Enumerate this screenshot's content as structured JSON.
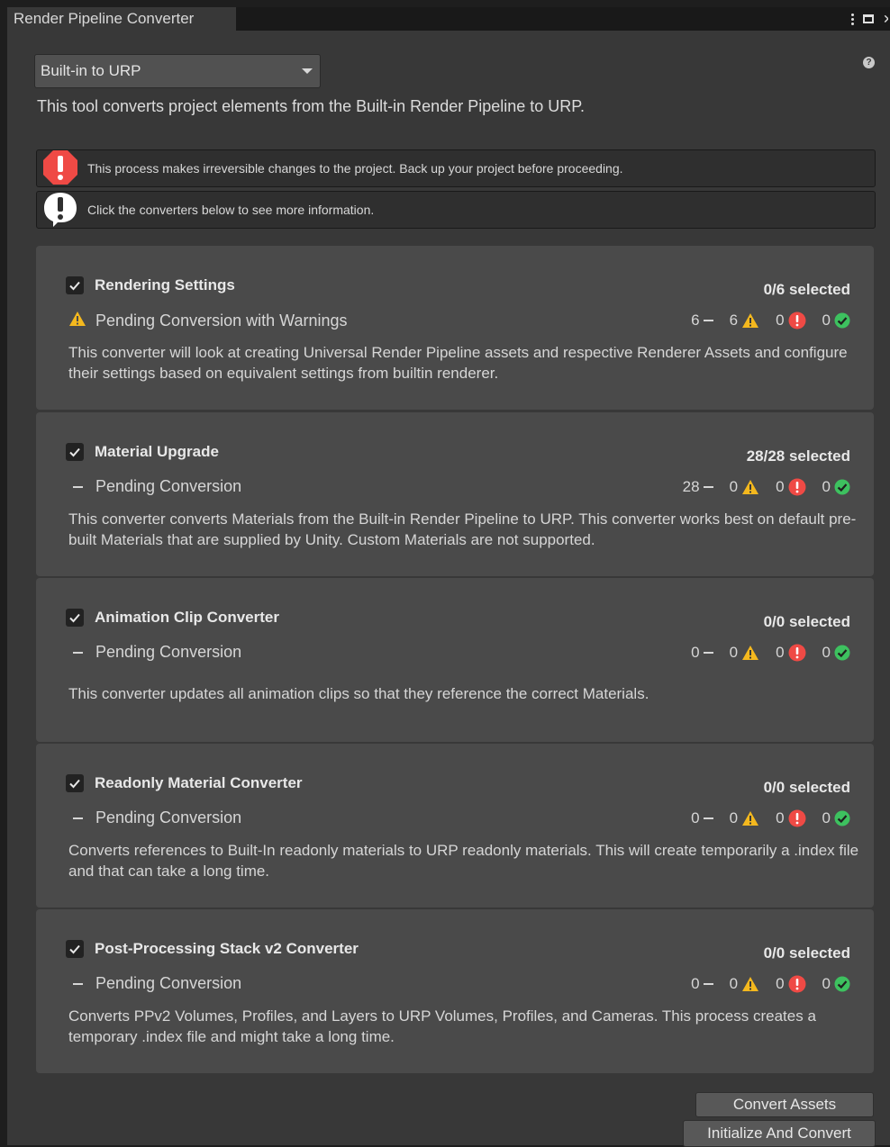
{
  "window": {
    "tab_title": "Render Pipeline Converter"
  },
  "dropdown": {
    "value": "Built-in to URP"
  },
  "description": "This tool converts project elements from the Built-in Render Pipeline to URP.",
  "help_boxes": [
    {
      "text": "This process makes irreversible changes to the project. Back up your project before proceeding."
    },
    {
      "text": "Click the converters below to see more information."
    }
  ],
  "converters": [
    {
      "name": "Rendering Settings",
      "selected": "0/6 selected",
      "status": "Pending Conversion with Warnings",
      "status_icon": "warning-icon",
      "count_pending": "6",
      "count_warnings": "6",
      "count_errors": "0",
      "count_success": "0",
      "description": "This converter will look at creating Universal Render Pipeline assets and respective Renderer Assets and configure their settings based on equivalent settings from builtin renderer."
    },
    {
      "name": "Material Upgrade",
      "selected": "28/28 selected",
      "status": "Pending Conversion",
      "status_icon": "dash-icon",
      "count_pending": "28",
      "count_warnings": "0",
      "count_errors": "0",
      "count_success": "0",
      "description": "This converter converts Materials from the Built-in Render Pipeline to URP. This converter works best on default pre-built Materials that are supplied by Unity. Custom Materials are not supported."
    },
    {
      "name": "Animation Clip Converter",
      "selected": "0/0 selected",
      "status": "Pending Conversion",
      "status_icon": "dash-icon",
      "count_pending": "0",
      "count_warnings": "0",
      "count_errors": "0",
      "count_success": "0",
      "description": "This converter updates all animation clips so that they reference the correct Materials."
    },
    {
      "name": "Readonly Material Converter",
      "selected": "0/0 selected",
      "status": "Pending Conversion",
      "status_icon": "dash-icon",
      "count_pending": "0",
      "count_warnings": "0",
      "count_errors": "0",
      "count_success": "0",
      "description": "Converts references to Built-In readonly materials to URP readonly materials. This will create temporarily a .index file and that can take a long time."
    },
    {
      "name": "Post-Processing Stack v2 Converter",
      "selected": "0/0 selected",
      "status": "Pending Conversion",
      "status_icon": "dash-icon",
      "count_pending": "0",
      "count_warnings": "0",
      "count_errors": "0",
      "count_success": "0",
      "description": "Converts PPv2 Volumes, Profiles, and Layers to URP Volumes, Profiles, and Cameras. This process creates a temporary .index file and might take a long time."
    }
  ],
  "buttons": {
    "convert": "Convert Assets",
    "initialize": "Initialize And Convert"
  },
  "colors": {
    "warning": "#f4b81e",
    "error": "#ef4a45",
    "success": "#3dc15f",
    "card": "#4a4a4a",
    "background": "#383838"
  }
}
